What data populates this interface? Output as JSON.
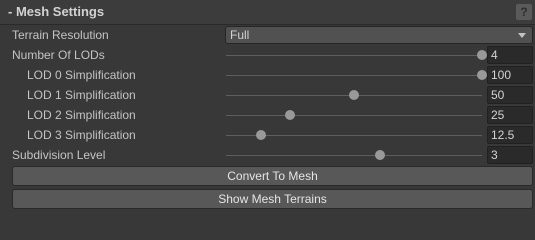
{
  "section": {
    "title": "- Mesh Settings",
    "help_glyph": "?"
  },
  "terrain_resolution": {
    "label": "Terrain Resolution",
    "value": "Full"
  },
  "sliders": [
    {
      "label": "Number Of LODs",
      "value": "4",
      "fraction": 1.0
    },
    {
      "label": "LOD 0 Simplification",
      "value": "100",
      "fraction": 1.0
    },
    {
      "label": "LOD 1 Simplification",
      "value": "50",
      "fraction": 0.5
    },
    {
      "label": "LOD 2 Simplification",
      "value": "25",
      "fraction": 0.25
    },
    {
      "label": "LOD 3 Simplification",
      "value": "12.5",
      "fraction": 0.135
    },
    {
      "label": "Subdivision Level",
      "value": "3",
      "fraction": 0.6
    }
  ],
  "buttons": {
    "convert": "Convert To Mesh",
    "show": "Show Mesh Terrains"
  }
}
